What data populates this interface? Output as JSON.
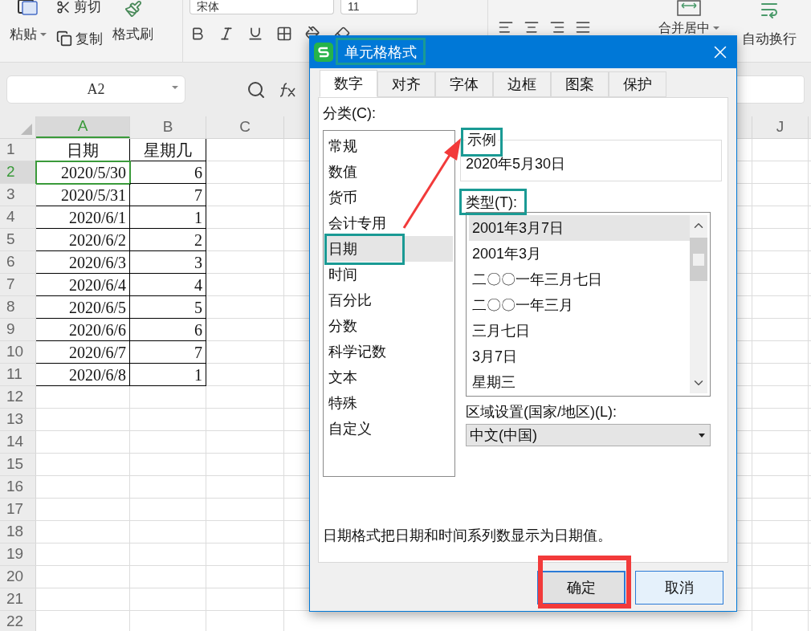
{
  "ribbon": {
    "paste": "粘贴",
    "cut": "剪切",
    "copy": "复制",
    "format_painter": "格式刷",
    "font": "宋体",
    "font_size": "11",
    "merge": "合并居中",
    "wrap": "自动换行"
  },
  "formula_bar": {
    "cell_ref": "A2"
  },
  "sheet": {
    "columns": [
      {
        "label": "A",
        "selected": true
      },
      {
        "label": "B",
        "selected": false
      },
      {
        "label": "C",
        "selected": false
      },
      {
        "label": "J",
        "selected": false
      }
    ],
    "rows": [
      {
        "number": "1",
        "selected": false,
        "kind": "header",
        "cells": [
          {
            "text": "日期",
            "selected": false
          },
          {
            "text": "星期几",
            "selected": false
          }
        ]
      },
      {
        "number": "2",
        "selected": true,
        "kind": "data",
        "cells": [
          {
            "text": "2020/5/30",
            "selected": true
          },
          {
            "text": "6",
            "selected": false
          }
        ]
      },
      {
        "number": "3",
        "selected": false,
        "kind": "data",
        "cells": [
          {
            "text": "2020/5/31",
            "selected": false
          },
          {
            "text": "7",
            "selected": false
          }
        ]
      },
      {
        "number": "4",
        "selected": false,
        "kind": "data",
        "cells": [
          {
            "text": "2020/6/1",
            "selected": false
          },
          {
            "text": "1",
            "selected": false
          }
        ]
      },
      {
        "number": "5",
        "selected": false,
        "kind": "data",
        "cells": [
          {
            "text": "2020/6/2",
            "selected": false
          },
          {
            "text": "2",
            "selected": false
          }
        ]
      },
      {
        "number": "6",
        "selected": false,
        "kind": "data",
        "cells": [
          {
            "text": "2020/6/3",
            "selected": false
          },
          {
            "text": "3",
            "selected": false
          }
        ]
      },
      {
        "number": "7",
        "selected": false,
        "kind": "data",
        "cells": [
          {
            "text": "2020/6/4",
            "selected": false
          },
          {
            "text": "4",
            "selected": false
          }
        ]
      },
      {
        "number": "8",
        "selected": false,
        "kind": "data",
        "cells": [
          {
            "text": "2020/6/5",
            "selected": false
          },
          {
            "text": "5",
            "selected": false
          }
        ]
      },
      {
        "number": "9",
        "selected": false,
        "kind": "data",
        "cells": [
          {
            "text": "2020/6/6",
            "selected": false
          },
          {
            "text": "6",
            "selected": false
          }
        ]
      },
      {
        "number": "10",
        "selected": false,
        "kind": "data",
        "cells": [
          {
            "text": "2020/6/7",
            "selected": false
          },
          {
            "text": "7",
            "selected": false
          }
        ]
      },
      {
        "number": "11",
        "selected": false,
        "kind": "data",
        "cells": [
          {
            "text": "2020/6/8",
            "selected": false
          },
          {
            "text": "1",
            "selected": false
          }
        ]
      },
      {
        "number": "12",
        "selected": false,
        "kind": "empty"
      },
      {
        "number": "13",
        "selected": false,
        "kind": "empty"
      },
      {
        "number": "14",
        "selected": false,
        "kind": "empty"
      },
      {
        "number": "15",
        "selected": false,
        "kind": "empty"
      },
      {
        "number": "16",
        "selected": false,
        "kind": "empty"
      },
      {
        "number": "17",
        "selected": false,
        "kind": "empty"
      },
      {
        "number": "18",
        "selected": false,
        "kind": "empty"
      },
      {
        "number": "19",
        "selected": false,
        "kind": "empty"
      },
      {
        "number": "20",
        "selected": false,
        "kind": "empty"
      },
      {
        "number": "21",
        "selected": false,
        "kind": "empty"
      },
      {
        "number": "22",
        "selected": false,
        "kind": "empty"
      }
    ]
  },
  "dialog": {
    "title": "单元格格式",
    "tabs": [
      {
        "label": "数字",
        "selected": true
      },
      {
        "label": "对齐",
        "selected": false
      },
      {
        "label": "字体",
        "selected": false
      },
      {
        "label": "边框",
        "selected": false
      },
      {
        "label": "图案",
        "selected": false
      },
      {
        "label": "保护",
        "selected": false
      }
    ],
    "category_label": "分类(C):",
    "categories": [
      {
        "label": "常规",
        "selected": false
      },
      {
        "label": "数值",
        "selected": false
      },
      {
        "label": "货币",
        "selected": false
      },
      {
        "label": "会计专用",
        "selected": false
      },
      {
        "label": "日期",
        "selected": true
      },
      {
        "label": "时间",
        "selected": false
      },
      {
        "label": "百分比",
        "selected": false
      },
      {
        "label": "分数",
        "selected": false
      },
      {
        "label": "科学记数",
        "selected": false
      },
      {
        "label": "文本",
        "selected": false
      },
      {
        "label": "特殊",
        "selected": false
      },
      {
        "label": "自定义",
        "selected": false
      }
    ],
    "sample": {
      "label": "示例",
      "value": "2020年5月30日"
    },
    "type_label": "类型(T):",
    "types": [
      {
        "label": "2001年3月7日",
        "selected": true
      },
      {
        "label": "2001年3月",
        "selected": false
      },
      {
        "label": "二〇〇一年三月七日",
        "selected": false
      },
      {
        "label": "二〇〇一年三月",
        "selected": false
      },
      {
        "label": "三月七日",
        "selected": false
      },
      {
        "label": "3月7日",
        "selected": false
      },
      {
        "label": "星期三",
        "selected": false
      }
    ],
    "locale": {
      "label": "区域设置(国家/地区)(L):",
      "value": "中文(中国)"
    },
    "description": "日期格式把日期和时间系列数显示为日期值。",
    "buttons": [
      {
        "label": "确定",
        "kind": "primary"
      },
      {
        "label": "取消",
        "kind": "secondary"
      }
    ]
  }
}
